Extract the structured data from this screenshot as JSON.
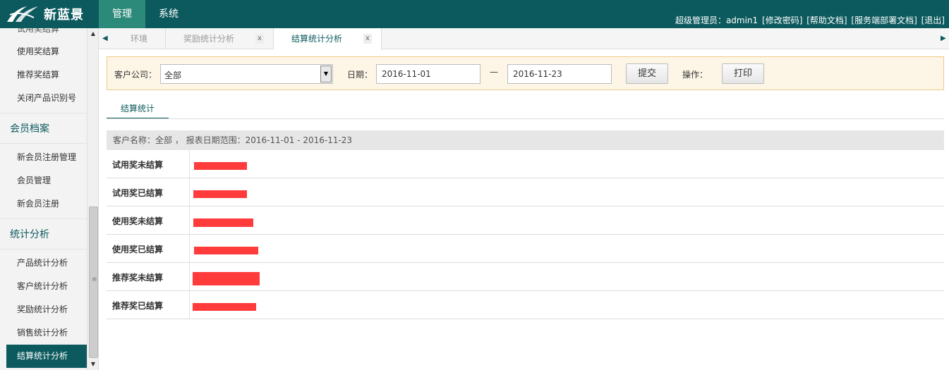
{
  "app": {
    "brand": "新蓝景",
    "nav": [
      "管理",
      "系统"
    ],
    "user_links": [
      "超级管理员：admin1",
      "[修改密码]",
      "[帮助文档]",
      "[服务端部署文档]",
      "[退出]"
    ]
  },
  "sidebar": {
    "items_top": [
      "试用奖结算",
      "使用奖结算",
      "推荐奖结算",
      "关闭产品识别号"
    ],
    "group_member": "会员档案",
    "member_items": [
      "新会员注册管理",
      "会员管理",
      "新会员注册"
    ],
    "group_stats": "统计分析",
    "stats_items": [
      "产品统计分析",
      "客户统计分析",
      "奖励统计分析",
      "销售统计分析",
      "结算统计分析"
    ]
  },
  "tabs": [
    {
      "label": "环境",
      "close": ""
    },
    {
      "label": "奖励统计分析",
      "close": "x"
    },
    {
      "label": "结算统计分析",
      "close": "x"
    }
  ],
  "filter": {
    "company_label": "客户公司：",
    "company_value": "全部",
    "date_label": "日期：",
    "date_from": "2016-11-01",
    "date_dash": "—",
    "date_to": "2016-11-23",
    "submit": "提交",
    "op_label": "操作：",
    "print": "打印"
  },
  "section_tab": "结算统计",
  "summary": "客户名称：全部 ， 报表日期范围：2016-11-01 - 2016-11-23",
  "rows": [
    "试用奖未结算",
    "试用奖已结算",
    "使用奖未结算",
    "使用奖已结算",
    "推荐奖未结算",
    "推荐奖已结算"
  ],
  "colors": {
    "header_bg": "#0c5a5e",
    "nav_active": "#2c8a7a",
    "redaction": "#ff3b3b",
    "filter_bg": "#fdf6e6"
  }
}
